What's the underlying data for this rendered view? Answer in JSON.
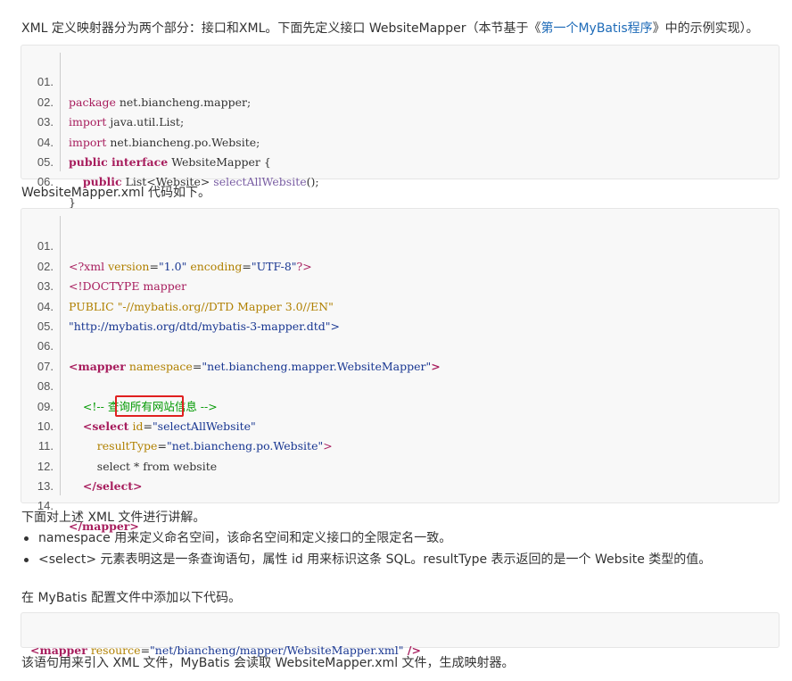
{
  "intro": {
    "before_link": "XML 定义映射器分为两个部分：接口和XML。下面先定义接口 WebsiteMapper（本节基于《",
    "link_text": "第一个MyBatis程序",
    "after_link": "》中的示例实现）。"
  },
  "code_java": {
    "lines": [
      {
        "no": "01.",
        "text": "package net.biancheng.mapper;"
      },
      {
        "no": "02.",
        "text": "import java.util.List;"
      },
      {
        "no": "03.",
        "text": "import net.biancheng.po.Website;"
      },
      {
        "no": "04.",
        "kw": "public interface",
        "text": " WebsiteMapper {"
      },
      {
        "no": "05.",
        "indent": "    ",
        "kw": "public",
        "text": " List<Website> ",
        "fn": "selectAllWebsite",
        "tail": "();"
      },
      {
        "no": "06.",
        "text": "}"
      }
    ],
    "package_kw": "package",
    "import_kw": "import"
  },
  "xml_intro": "WebsiteMapper.xml 代码如下。",
  "code_xml": {
    "line_numbers": [
      "01.",
      "02.",
      "03.",
      "04.",
      "05.",
      "06.",
      "07.",
      "08.",
      "09.",
      "10.",
      "11.",
      "12.",
      "13.",
      "14."
    ],
    "l1_a": "<?xml ",
    "l1_attr1": "version",
    "l1_eq": "=",
    "l1_val1": "\"1.0\"",
    "l1_attr2": "encoding",
    "l1_val2": "\"UTF-8\"",
    "l1_end": "?>",
    "l2": "<!DOCTYPE mapper",
    "l3": "PUBLIC \"-//mybatis.org//DTD Mapper 3.0//EN\"",
    "l4": "\"http://mybatis.org/dtd/mybatis-3-mapper.dtd\">",
    "l6_tag": "<mapper",
    "l6_attr": "namespace",
    "l6_val": "\"net.biancheng.mapper.WebsiteMapper\"",
    "l6_end": ">",
    "l8_comment": "<!-- 查询所有网站信息 -->",
    "l9_tag": "<select",
    "l9_attr": "id",
    "l9_val": "\"selectAllWebsite\"",
    "l10_attr": "resultType",
    "l10_val": "\"net.biancheng.po.Website\"",
    "l10_end": ">",
    "l11": "select * from website",
    "l12_tag": "</select>",
    "l14_tag": "</mapper>"
  },
  "explain": {
    "heading": "下面对上述 XML 文件进行讲解。",
    "bullets": [
      "namespace 用来定义命名空间，该命名空间和定义接口的全限定名一致。",
      "<select> 元素表明这是一条查询语句，属性 id 用来标识这条 SQL。resultType 表示返回的是一个 Website 类型的值。"
    ]
  },
  "config_intro": "在 MyBatis 配置文件中添加以下代码。",
  "code_config": {
    "tag": "<mapper",
    "attr": "resource",
    "eq": "=",
    "val": "\"net/biancheng/mapper/WebsiteMapper.xml\"",
    "end": " />"
  },
  "footer_text": "该语句用来引入 XML 文件，MyBatis 会读取 WebsiteMapper.xml 文件，生成映射器。",
  "colors": {
    "keyword": "#a71d5d",
    "string": "#183691",
    "attribute": "#b08000",
    "comment": "#009900",
    "link": "#1e6bb8",
    "highlight_box": "#e02020"
  }
}
